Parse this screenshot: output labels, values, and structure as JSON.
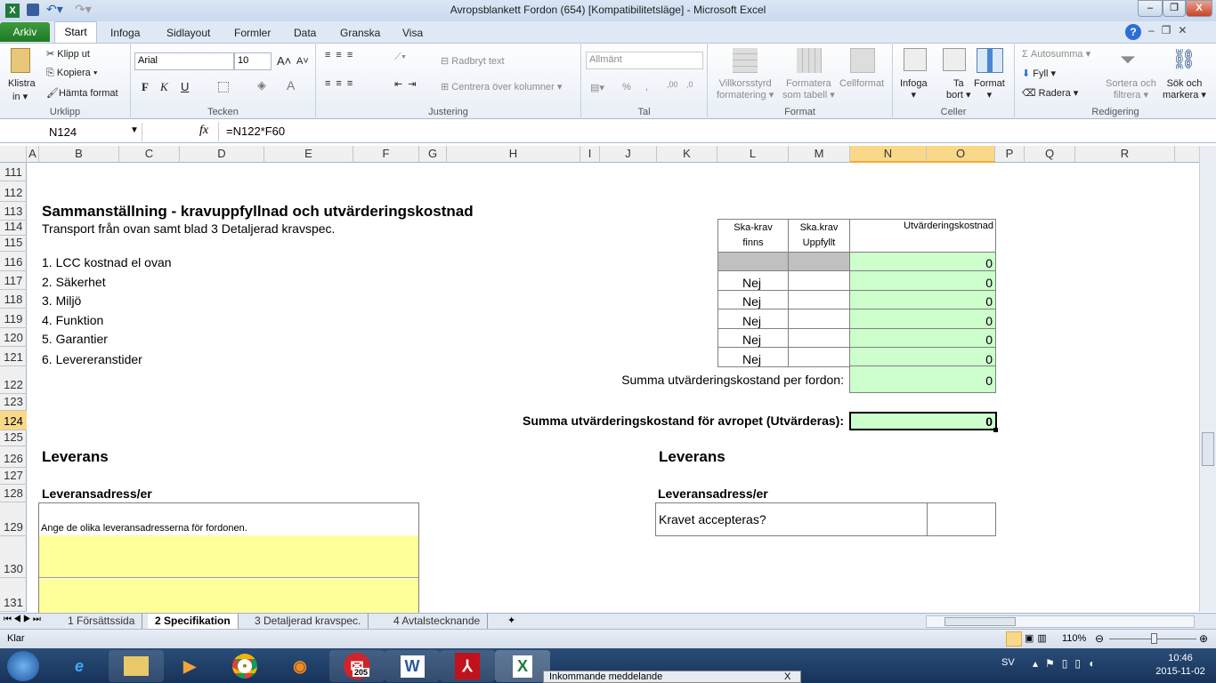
{
  "window": {
    "title": "Avropsblankett Fordon (654)  [Kompatibilitetsläge]  -  Microsoft Excel",
    "minimize": "–",
    "restore": "❐",
    "close": "X"
  },
  "ribbon_tabs": [
    "Arkiv",
    "Start",
    "Infoga",
    "Sidlayout",
    "Formler",
    "Data",
    "Granska",
    "Visa"
  ],
  "ribbon": {
    "clipboard": {
      "paste": "Klistra",
      "paste2": "in ▾",
      "cut": "Klipp ut",
      "copy": "Kopiera ▾",
      "format_painter": "Hämta format",
      "label": "Urklipp"
    },
    "font": {
      "name": "Arial",
      "size": "10",
      "grow": "A˄",
      "shrink": "A˅",
      "bold": "F",
      "italic": "K",
      "underline": "U",
      "label": "Tecken"
    },
    "alignment": {
      "wrap": "Radbryt text",
      "merge": "Centrera över kolumner",
      "label": "Justering"
    },
    "number": {
      "format": "Allmänt",
      "percent": "%",
      "comma": ",",
      "inc": ",00",
      "dec": ",0",
      "label": "Tal"
    },
    "styles": {
      "cond": "Villkorsstyrd",
      "cond2": "formatering ▾",
      "table": "Formatera",
      "table2": "som tabell ▾",
      "cell": "Cellformat",
      "label": "Format"
    },
    "cells": {
      "insert": "Infoga",
      "delete": "Ta",
      "delete2": "bort ▾",
      "format": "Format",
      "label": "Celler"
    },
    "editing": {
      "autosum": "Autosumma ▾",
      "fill": "Fyll ▾",
      "clear": "Radera ▾",
      "sort": "Sortera och",
      "sort2": "filtrera ▾",
      "find": "Sök och",
      "find2": "markera ▾",
      "label": "Redigering"
    }
  },
  "formula_bar": {
    "name_box": "N124",
    "fx": "fx",
    "formula": "=N122*F60"
  },
  "columns": [
    "A",
    "B",
    "C",
    "D",
    "E",
    "F",
    "G",
    "H",
    "I",
    "J",
    "K",
    "L",
    "M",
    "N",
    "O",
    "P",
    "Q",
    "R"
  ],
  "selected_columns": [
    "N",
    "O"
  ],
  "rows": [
    "111",
    "112",
    "113",
    "114",
    "115",
    "116",
    "117",
    "118",
    "119",
    "120",
    "121",
    "122",
    "123",
    "124",
    "125",
    "126",
    "127",
    "128",
    "129",
    "130",
    "131"
  ],
  "selected_row": "124",
  "sheet": {
    "heading": "Sammanställning - kravuppfyllnad och utvärderingskostnad",
    "subheading": "Transport från ovan samt blad 3 Detaljerad kravspec.",
    "items": [
      "1. LCC kostnad el ovan",
      "2. Säkerhet",
      "3. Miljö",
      "4. Funktion",
      "5. Garantier",
      "6. Levereranstider"
    ],
    "table_headers": {
      "l1": "Ska-krav",
      "l2": "finns",
      "m1": "Ska.krav",
      "m2": "Uppfyllt",
      "n": "Utvärderingskostnad"
    },
    "table_rows": [
      {
        "finns": "",
        "uppfyllt": "",
        "kostnad": "0"
      },
      {
        "finns": "Nej",
        "uppfyllt": "",
        "kostnad": "0"
      },
      {
        "finns": "Nej",
        "uppfyllt": "",
        "kostnad": "0"
      },
      {
        "finns": "Nej",
        "uppfyllt": "",
        "kostnad": "0"
      },
      {
        "finns": "Nej",
        "uppfyllt": "",
        "kostnad": "0"
      },
      {
        "finns": "Nej",
        "uppfyllt": "",
        "kostnad": "0"
      }
    ],
    "sum_per_label": "Summa utvärderingskostand per fordon:",
    "sum_per_value": "0",
    "sum_total_label": "Summa utvärderingskostand för avropet (Utvärderas):",
    "sum_total_value": "0",
    "leverans_left": "Leverans",
    "address_left": "Leveransadress/er",
    "address_hint": "Ange  de olika leveransadresserna för fordonen.",
    "leverans_right": "Leverans",
    "address_right": "Leveransadress/er",
    "accept_q": "Kravet accepteras?",
    "accept_value": ""
  },
  "sheet_tabs": [
    "1 Försättssida",
    "2 Specifikation",
    "3 Detaljerad kravspec.",
    "4 Avtalstecknande"
  ],
  "active_sheet": "2 Specifikation",
  "status": {
    "ready": "Klar",
    "zoom": "110%"
  },
  "taskbar": {
    "items": [
      "start",
      "internet-explorer",
      "file-explorer",
      "media-player",
      "chrome",
      "firefox",
      "mail",
      "word",
      "acrobat",
      "excel"
    ],
    "mail_badge": "205",
    "lang": "SV",
    "time": "10:46",
    "date": "2015-11-02",
    "popup": "Inkommande meddelande",
    "popup_close": "X"
  },
  "colors": {
    "green_fill": "#ccffcc",
    "grey_fill": "#c0c0c0",
    "yellow_fill": "#ffff99",
    "selection": "#f9d889"
  }
}
